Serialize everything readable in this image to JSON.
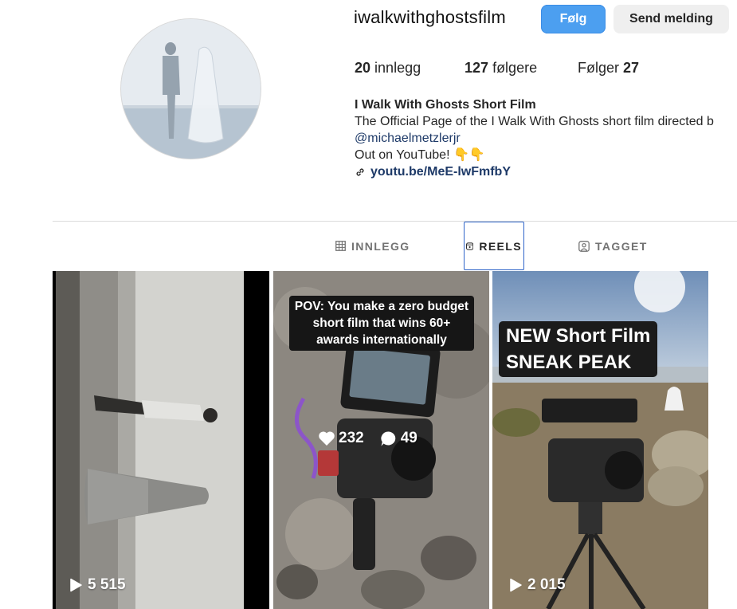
{
  "profile": {
    "username": "iwalkwithghostsfilm",
    "follow_label": "Følg",
    "message_label": "Send melding"
  },
  "stats": {
    "posts_count": "20",
    "posts_label": "innlegg",
    "followers_count": "127",
    "followers_label": "følgere",
    "following_label": "Følger",
    "following_count": "27"
  },
  "bio": {
    "name": "I Walk With Ghosts Short Film",
    "line1": "The Official Page of the I Walk With Ghosts short film directed b",
    "mention": "@michaelmetzlerjr",
    "line3": "Out on YouTube! 👇👇",
    "link": "youtu.be/MeE-lwFmfbY"
  },
  "tabs": [
    {
      "label": "INNLEGG",
      "icon": "grid-icon"
    },
    {
      "label": "REELS",
      "icon": "reels-icon",
      "active": true
    },
    {
      "label": "TAGGET",
      "icon": "tagged-icon"
    }
  ],
  "reels": [
    {
      "views": "5 515"
    },
    {
      "caption": "POV: You make a zero budget\nshort film that wins 60+\nawards internationally",
      "likes": "232",
      "comments": "49"
    },
    {
      "caption": "NEW Short Film\nSNEAK PEAK",
      "views": "2 015"
    }
  ],
  "colors": {
    "follow_button": "#4c9ff0",
    "link": "#1e3a68",
    "active_tab_border": "#2f65c9"
  }
}
